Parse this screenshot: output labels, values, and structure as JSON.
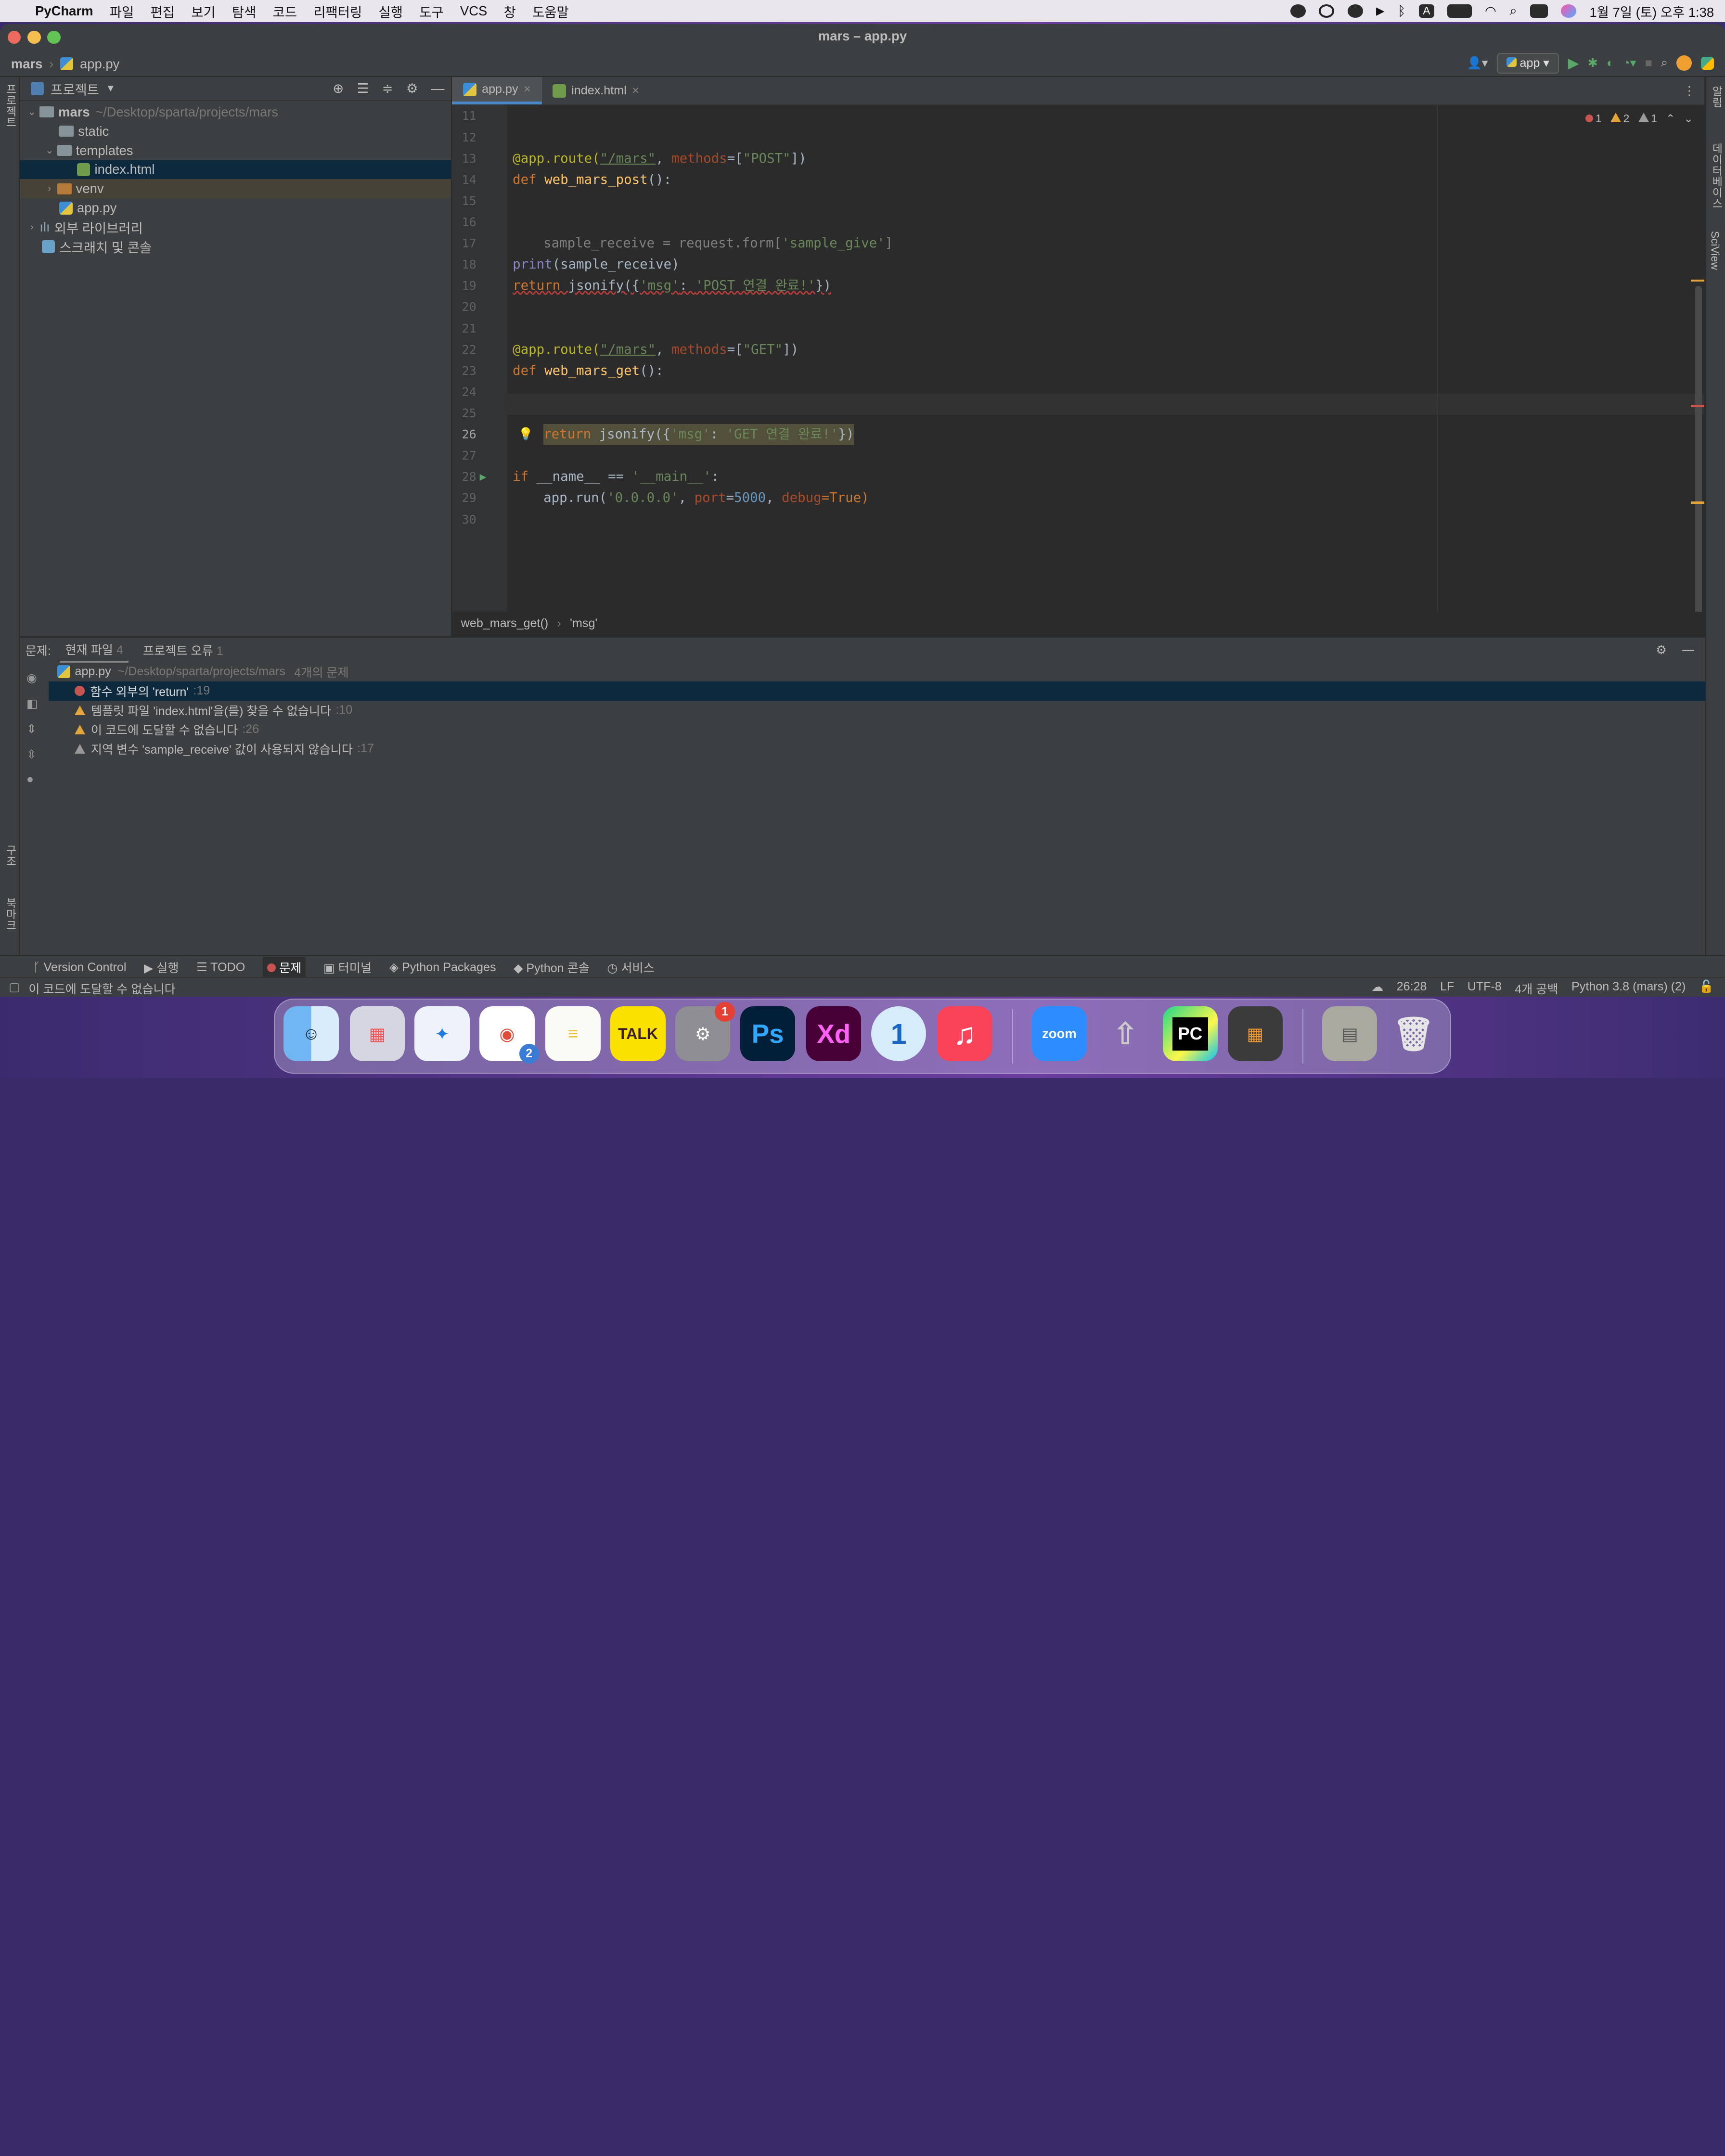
{
  "menubar": {
    "app": "PyCharm",
    "items": [
      "파일",
      "편집",
      "보기",
      "탐색",
      "코드",
      "리팩터링",
      "실행",
      "도구",
      "VCS",
      "창",
      "도움말"
    ],
    "clock": "1월 7일 (토) 오후 1:38",
    "input_badge": "A"
  },
  "window": {
    "title": "mars – app.py"
  },
  "breadcrumb": {
    "project": "mars",
    "file": "app.py"
  },
  "toolbar": {
    "run_config": "app"
  },
  "left_strip": {
    "project": "프로젝트",
    "structure": "구조",
    "bookmarks": "북마크"
  },
  "right_strip": {
    "notifications": "알림",
    "database": "데이터베이스",
    "sciview": "SciView"
  },
  "project_panel": {
    "header": "프로젝트",
    "tree": [
      {
        "name": "mars",
        "path": "~/Desktop/sparta/projects/mars"
      },
      {
        "name": "static"
      },
      {
        "name": "templates"
      },
      {
        "name": "index.html"
      },
      {
        "name": "venv"
      },
      {
        "name": "app.py"
      },
      {
        "name": "외부 라이브러리"
      },
      {
        "name": "스크래치 및 콘솔"
      }
    ]
  },
  "editor": {
    "tabs": [
      {
        "label": "app.py"
      },
      {
        "label": "index.html"
      }
    ],
    "inspections": {
      "errors": "1",
      "warnings": "2",
      "weak": "1"
    },
    "line_numbers": [
      "11",
      "12",
      "13",
      "14",
      "15",
      "16",
      "17",
      "18",
      "19",
      "20",
      "21",
      "22",
      "23",
      "24",
      "25",
      "26",
      "27",
      "28",
      "29",
      "30"
    ],
    "current_line": "26",
    "code": {
      "l13a": "@app.route(",
      "l13b": "\"/mars\"",
      "l13c": ", ",
      "l13d": "methods",
      "l13e": "=[",
      "l13f": "\"POST\"",
      "l13g": "])",
      "def": "def ",
      "l14n": "web_mars_post",
      "l14e": "():",
      "l17a": "sample_receive = request.form[",
      "l17b": "'sample_give'",
      "l17c": "]",
      "l18a": "print",
      "l18b": "(sample_receive)",
      "ret": "return ",
      "l19a": "jsonify({",
      "l19b": "'msg'",
      "l19c": ": ",
      "l19d": "'POST 연결 완료!'",
      "l19e": "})",
      "l22f": "\"GET\"",
      "l23n": "web_mars_get",
      "l26d": "'GET 연결 완료!'",
      "l28a": "if ",
      "l28b": "__name__ == ",
      "l28c": "'__main__'",
      "l28d": ":",
      "l29a": "app.run(",
      "l29b": "'0.0.0.0'",
      "l29c": ", ",
      "l29d": "port",
      "l29e": "=",
      "l29f": "5000",
      "l29g": ", ",
      "l29h": "debug",
      "l29i": "=True)"
    },
    "crumbs": [
      "web_mars_get()",
      "'msg'"
    ]
  },
  "problems": {
    "label": "문제:",
    "tab_current": "현재 파일",
    "tab_current_count": "4",
    "tab_project": "프로젝트 오류",
    "tab_project_count": "1",
    "file": "app.py",
    "file_path": "~/Desktop/sparta/projects/mars",
    "file_count": "4개의 문제",
    "items": [
      {
        "text": "함수 외부의 'return'",
        "line": ":19"
      },
      {
        "text": "템플릿 파일 'index.html'을(를) 찾을 수 없습니다",
        "line": ":10"
      },
      {
        "text": "이 코드에 도달할 수 없습니다",
        "line": ":26"
      },
      {
        "text": "지역 변수 'sample_receive' 값이 사용되지 않습니다",
        "line": ":17"
      }
    ]
  },
  "tool_windows": [
    "Version Control",
    "실행",
    "TODO",
    "문제",
    "터미널",
    "Python Packages",
    "Python 콘솔",
    "서비스"
  ],
  "status": {
    "message": "이 코드에 도달할 수 없습니다",
    "position": "26:28",
    "line_sep": "LF",
    "encoding": "UTF-8",
    "indent": "4개 공백",
    "interpreter": "Python 3.8 (mars) (2)"
  },
  "dock": {
    "apps": [
      {
        "name": "Finder"
      },
      {
        "name": "Launchpad"
      },
      {
        "name": "Safari"
      },
      {
        "name": "Chrome",
        "badge": "2"
      },
      {
        "name": "Notes"
      },
      {
        "name": "KakaoTalk",
        "label": "TALK"
      },
      {
        "name": "System Preferences",
        "badge": "1"
      },
      {
        "name": "Photoshop",
        "label": "Ps"
      },
      {
        "name": "Adobe XD",
        "label": "Xd"
      },
      {
        "name": "1Password",
        "label": "1"
      },
      {
        "name": "Music",
        "label": "♫"
      },
      {
        "name": "Zoom",
        "label": "zoom"
      },
      {
        "name": "Rocket"
      },
      {
        "name": "PyCharm",
        "label": "PC"
      },
      {
        "name": "Calculator"
      },
      {
        "name": "Documents"
      },
      {
        "name": "Trash"
      }
    ]
  },
  "colors": {
    "accent": "#4a88c7",
    "error": "#c75450",
    "warning": "#e2a53a",
    "keyword": "#cc7832",
    "string": "#6a8759"
  }
}
